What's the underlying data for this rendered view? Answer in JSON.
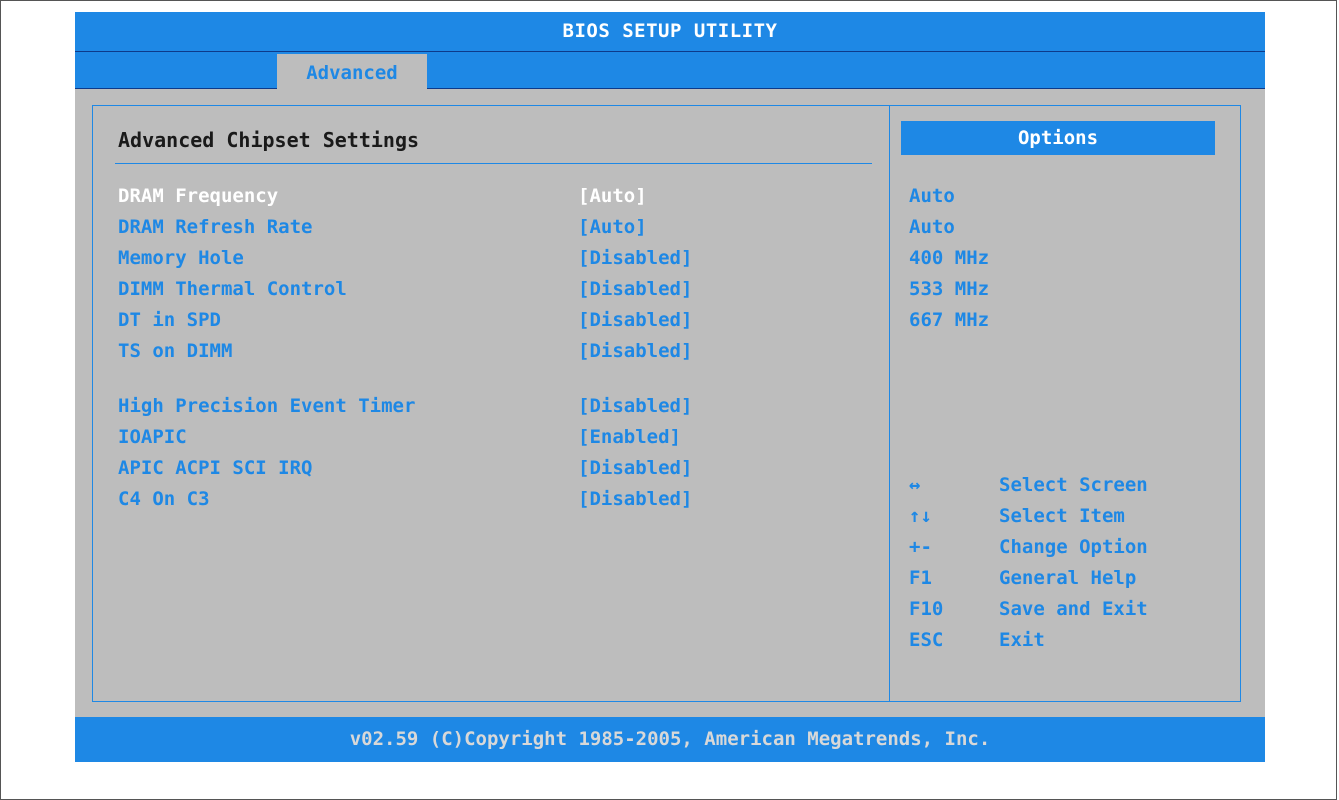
{
  "title": "BIOS SETUP UTILITY",
  "tabs": [
    {
      "label": "Advanced"
    }
  ],
  "page_title": "Advanced Chipset Settings",
  "settings": [
    {
      "name": "DRAM Frequency",
      "value": "[Auto]"
    },
    {
      "name": "DRAM Refresh Rate",
      "value": "[Auto]"
    },
    {
      "name": "Memory Hole",
      "value": "[Disabled]"
    },
    {
      "name": "DIMM Thermal Control",
      "value": "[Disabled]"
    },
    {
      "name": "DT in SPD",
      "value": "[Disabled]"
    },
    {
      "name": "TS on DIMM",
      "value": "[Disabled]"
    },
    {
      "name": "High Precision Event Timer",
      "value": "[Disabled]"
    },
    {
      "name": "IOAPIC",
      "value": "[Enabled]"
    },
    {
      "name": "APIC ACPI SCI IRQ",
      "value": "[Disabled]"
    },
    {
      "name": "C4 On C3",
      "value": "[Disabled]"
    }
  ],
  "selected_setting": "DRAM Frequency",
  "options_panel": {
    "header": "Options",
    "items": [
      "Auto",
      "Auto",
      "400 MHz",
      "533 MHz",
      "667 MHz"
    ]
  },
  "help": [
    {
      "key": "↔",
      "desc": "Select Screen"
    },
    {
      "key": "↑↓",
      "desc": "Select Item"
    },
    {
      "key": "+-",
      "desc": "Change Option"
    },
    {
      "key": "F1",
      "desc": "General Help"
    },
    {
      "key": "F10",
      "desc": "Save and Exit"
    },
    {
      "key": "ESC",
      "desc": "Exit"
    }
  ],
  "footer": "v02.59 (C)Copyright 1985-2005, American Megatrends, Inc.",
  "colors": {
    "accent": "#1e88e5",
    "background": "#bdbdbd",
    "selected_text": "#ffffff"
  }
}
